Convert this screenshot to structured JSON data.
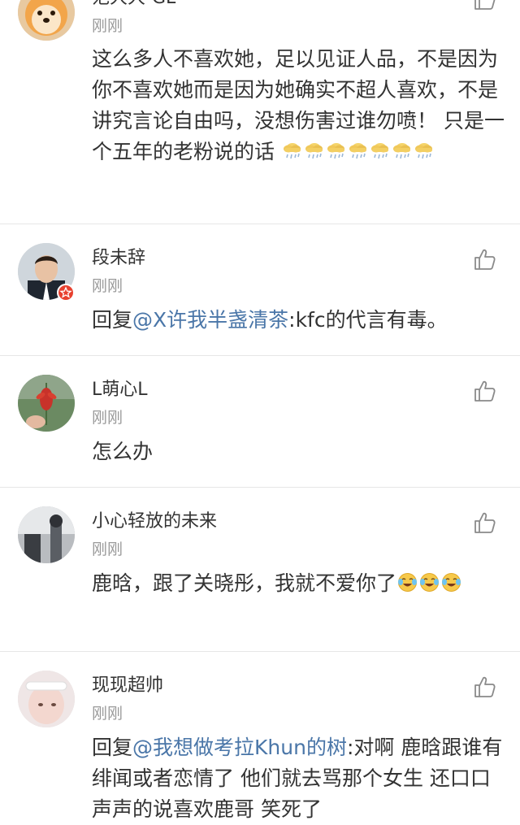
{
  "comments": [
    {
      "username": "范大大-GL",
      "time": "刚刚",
      "text": "这么多人不喜欢她，足以见证人品，不是因为你不喜欢她而是因为她确实不超人喜欢，不是讲究言论自由吗，没想伤害过谁勿喷！   只是一个五年的老粉说的话",
      "emojis": [
        "cloud-rain-emoji",
        "cloud-rain-emoji",
        "cloud-rain-emoji",
        "cloud-rain-emoji",
        "cloud-rain-emoji",
        "cloud-rain-emoji",
        "cloud-rain-emoji"
      ]
    },
    {
      "username": "段未辞",
      "time": "刚刚",
      "reply_prefix": "回复",
      "mention": "@X许我半盏清茶",
      "text": ":kfc的代言有毒。",
      "verified": true
    },
    {
      "username": "L萌心L",
      "time": "刚刚",
      "text": "怎么办"
    },
    {
      "username": "小心轻放的未来",
      "time": "刚刚",
      "text": "鹿晗，跟了关晓彤，我就不爱你了",
      "emojis": [
        "laugh-cry-emoji",
        "laugh-cry-emoji",
        "laugh-cry-emoji"
      ]
    },
    {
      "username": "现现超帅",
      "time": "刚刚",
      "reply_prefix": "回复",
      "mention": "@我想做考拉Khun的树",
      "text": ":对啊  鹿晗跟谁有绯闻或者恋情了   他们就去骂那个女生 还口口声声的说喜欢鹿哥 笑死了"
    }
  ],
  "colors": {
    "mention": "#4a76a8",
    "time": "#999999",
    "text": "#333333",
    "divider": "#e6e6e6",
    "badge": "#e8412f"
  }
}
